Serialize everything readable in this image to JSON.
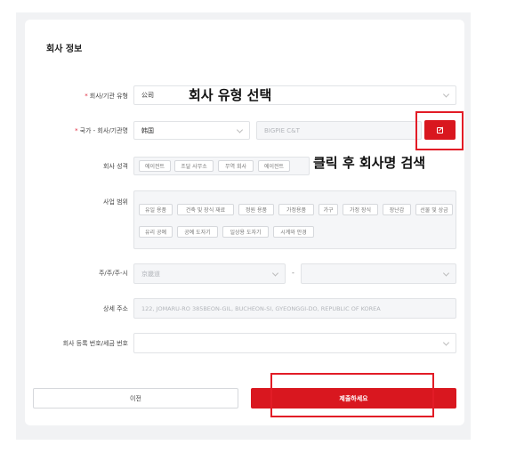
{
  "section_title": "회사 정보",
  "fields": {
    "company_type": {
      "label": "회사/기관 유형",
      "value": "公司",
      "required": true
    },
    "country_name": {
      "label": "국가 - 회사/기관명",
      "country_value": "韩国",
      "company_placeholder": "BIGPIE C&T",
      "required": true
    },
    "company_nature": {
      "label": "회사 성격",
      "tags": [
        "에이전트",
        "조달 사무소",
        "무역 회사",
        "에이전트"
      ]
    },
    "business_scope": {
      "label": "사업 범위",
      "tags": [
        "유일 용품",
        "건축 및 장식 재료",
        "정원 용품",
        "가정용품",
        "가구",
        "가정 장식",
        "장난감",
        "선물 및 상금",
        "유리 공예",
        "공예 도자기",
        "일상용 도자기",
        "시계와 안경"
      ]
    },
    "state_city": {
      "label": "주/주/주-시",
      "state_value": "京畿道",
      "dash": "-"
    },
    "address": {
      "label": "상세 주소",
      "value": "122, JOMARU-RO 385BEON-GIL, BUCHEON-SI, GYEONGGI-DO, REPUBLIC OF KOREA"
    },
    "registration": {
      "label": "회사 등록 번호/세금 번호"
    }
  },
  "buttons": {
    "prev": "이전",
    "submit": "제출하세요"
  },
  "annotations": {
    "type_select": "회사 유형 선택",
    "click_search": "클릭 후 회사명 검색"
  },
  "colors": {
    "accent": "#d9171f",
    "annotation": "#e21c26",
    "required": "#e0263b"
  },
  "icons": {
    "search_button": "edit-icon",
    "dropdown": "chevron-down-icon"
  }
}
